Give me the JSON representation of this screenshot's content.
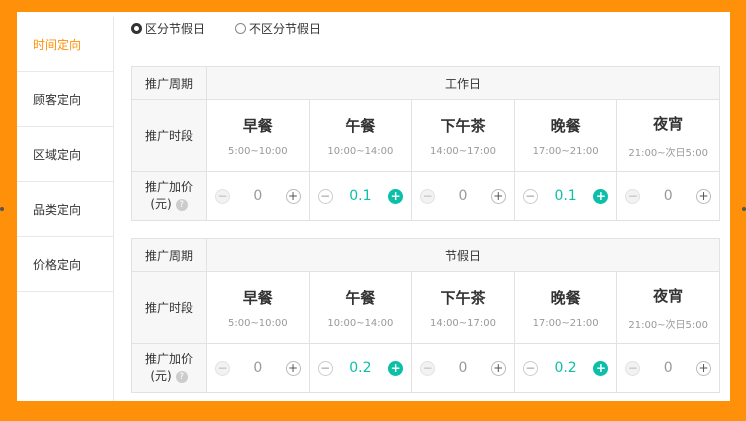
{
  "sidebar": {
    "items": [
      {
        "label": "时间定向",
        "active": true
      },
      {
        "label": "顾客定向"
      },
      {
        "label": "区域定向"
      },
      {
        "label": "品类定向"
      },
      {
        "label": "价格定向"
      }
    ]
  },
  "mode": {
    "options": [
      "区分节假日",
      "不区分节假日"
    ],
    "selected": 0
  },
  "labels": {
    "period": "推广周期",
    "slot": "推广时段",
    "price_a": "推广加价",
    "price_b": "(元)",
    "help_icon": "?"
  },
  "stepper": {
    "minus": "−",
    "plus": "+"
  },
  "accent": "#0cbfa8",
  "brand": "#ff9009",
  "tables": [
    {
      "period": "工作日",
      "slots": [
        {
          "name": "早餐",
          "time": "5:00~10:00",
          "value": "0"
        },
        {
          "name": "午餐",
          "time": "10:00~14:00",
          "value": "0.1"
        },
        {
          "name": "下午茶",
          "time": "14:00~17:00",
          "value": "0"
        },
        {
          "name": "晚餐",
          "time": "17:00~21:00",
          "value": "0.1"
        },
        {
          "name": "夜宵",
          "time": "21:00~次日5:00",
          "value": "0"
        }
      ]
    },
    {
      "period": "节假日",
      "slots": [
        {
          "name": "早餐",
          "time": "5:00~10:00",
          "value": "0"
        },
        {
          "name": "午餐",
          "time": "10:00~14:00",
          "value": "0.2"
        },
        {
          "name": "下午茶",
          "time": "14:00~17:00",
          "value": "0"
        },
        {
          "name": "晚餐",
          "time": "17:00~21:00",
          "value": "0.2"
        },
        {
          "name": "夜宵",
          "time": "21:00~次日5:00",
          "value": "0"
        }
      ]
    }
  ]
}
